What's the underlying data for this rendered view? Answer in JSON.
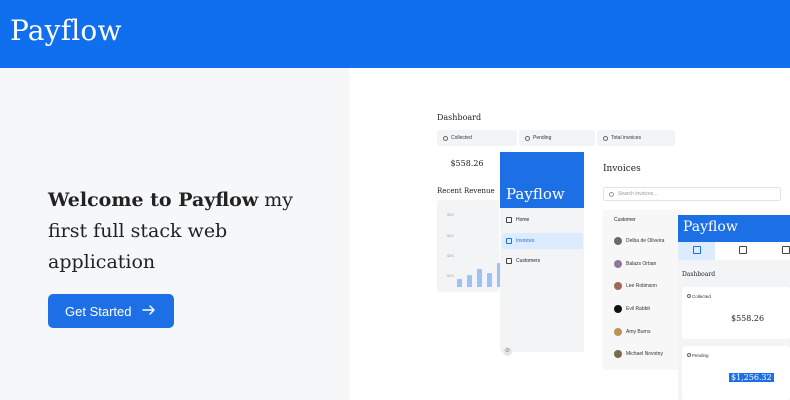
{
  "header": {
    "brand": "Payflow"
  },
  "hero": {
    "title_bold": "Welcome to Payflow",
    "title_rest": " my first full stack web application",
    "cta_label": "Get Started"
  },
  "preview": {
    "dashboard_title": "Dashboard",
    "chips": [
      "Collected",
      "Pending",
      "Total invoices"
    ],
    "collected_amount": "$558.26",
    "recent_revenue_title": "Recent Revenue",
    "revenue_axis_labels": [
      "$5K",
      "$4K",
      "$3K",
      "$2K"
    ],
    "revenue_bar_levels": [
      0.2,
      0.3,
      0.45,
      0.35,
      0.6
    ],
    "sidebar_brand": "Payflow",
    "nav": [
      "Home",
      "Invoices",
      "Customers"
    ],
    "invoices_title": "Invoices",
    "search_placeholder": "Search invoices...",
    "customer_header": "Customer",
    "customers": [
      "Delba de Oliveira",
      "Balazs Orban",
      "Lee Robinson",
      "Evil Rabbit",
      "Amy Burns",
      "Michael Novotny"
    ],
    "mobile_brand": "Payflow",
    "mobile_dashboard_title": "Dashboard",
    "mobile_cards": [
      {
        "label": "Collected",
        "value": "$558.26"
      },
      {
        "label": "Pending",
        "value": "$1,256.32"
      }
    ]
  },
  "colors": {
    "brand_blue": "#0F6FEF",
    "button_blue": "#1D6FE6",
    "left_bg": "#F6F7F9"
  }
}
